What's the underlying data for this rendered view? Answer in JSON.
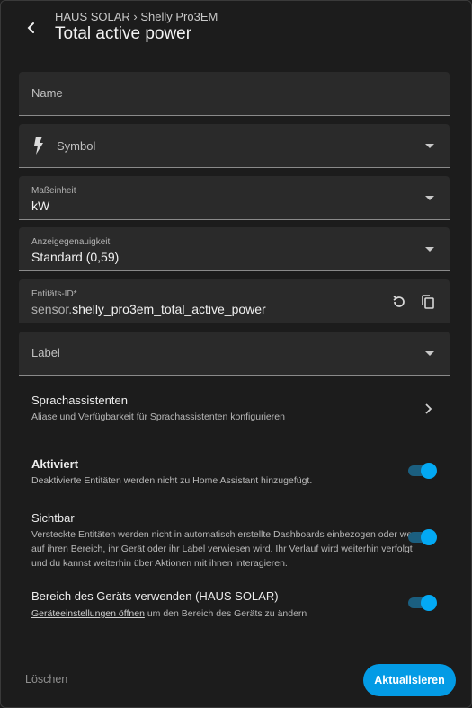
{
  "header": {
    "breadcrumb": "HAUS SOLAR › Shelly Pro3EM",
    "title": "Total active power"
  },
  "fields": {
    "name_label": "Name",
    "symbol_label": "Symbol",
    "unit_label": "Maßeinheit",
    "unit_value": "kW",
    "precision_label": "Anzeigegenauigkeit",
    "precision_value": "Standard (0,59)",
    "entity_id_label": "Entitäts-ID*",
    "entity_id_domain": "sensor.",
    "entity_id_value": "shelly_pro3em_total_active_power",
    "label_label": "Label"
  },
  "voice": {
    "title": "Sprachassistenten",
    "desc": "Aliase und Verfügbarkeit für Sprachassistenten konfigurieren"
  },
  "enabled": {
    "title": "Aktiviert",
    "desc": "Deaktivierte Entitäten werden nicht zu Home Assistant hinzugefügt.",
    "on": true
  },
  "visible": {
    "title": "Sichtbar",
    "desc": "Versteckte Entitäten werden nicht in automatisch erstellte Dashboards einbezogen oder wenn auf ihren Bereich, ihr Gerät oder ihr Label verwiesen wird. Ihr Verlauf wird weiterhin verfolgt und du kannst weiterhin über Aktionen mit ihnen interagieren.",
    "on": true
  },
  "area": {
    "title": "Bereich des Geräts verwenden (HAUS SOLAR)",
    "link": "Geräteeinstellungen öffnen",
    "desc_rest": " um den Bereich des Geräts zu ändern",
    "on": true
  },
  "footer": {
    "delete_label": "Löschen",
    "update_label": "Aktualisieren"
  },
  "icons": [
    "back-arrow-icon",
    "lightning-icon",
    "chevron-down-icon",
    "reset-icon",
    "copy-icon",
    "chevron-right-icon"
  ],
  "colors": {
    "accent": "#03a9f4",
    "background": "#1c1c1c",
    "field": "#2a2a2a"
  }
}
